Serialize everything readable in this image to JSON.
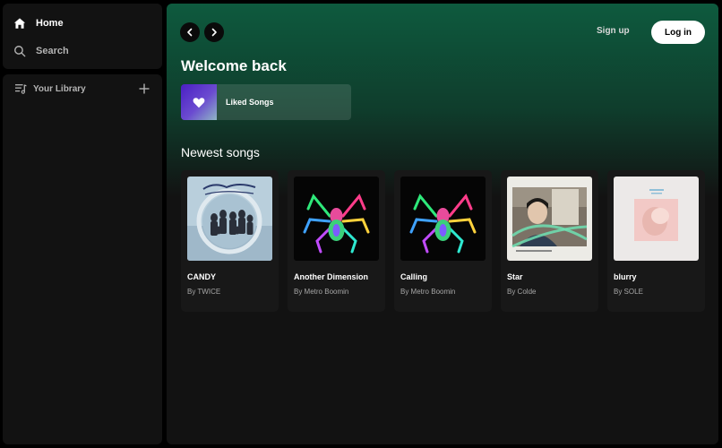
{
  "nav": {
    "home_label": "Home",
    "search_label": "Search"
  },
  "library": {
    "title": "Your Library"
  },
  "header": {
    "signup_label": "Sign up",
    "login_label": "Log in"
  },
  "main": {
    "greeting": "Welcome back",
    "liked_songs_label": "Liked Songs",
    "newest_title": "Newest songs",
    "songs": [
      {
        "title": "CANDY",
        "artist": "By TWICE"
      },
      {
        "title": "Another Dimension",
        "artist": "By Metro Boomin"
      },
      {
        "title": "Calling",
        "artist": "By Metro Boomin"
      },
      {
        "title": "Star",
        "artist": "By Colde"
      },
      {
        "title": "blurry",
        "artist": "By SOLE"
      }
    ]
  },
  "colors": {
    "accent_green": "#0e5a3e",
    "panel": "#121212",
    "card": "#181818",
    "liked_gradient_start": "#4a1fc4"
  }
}
